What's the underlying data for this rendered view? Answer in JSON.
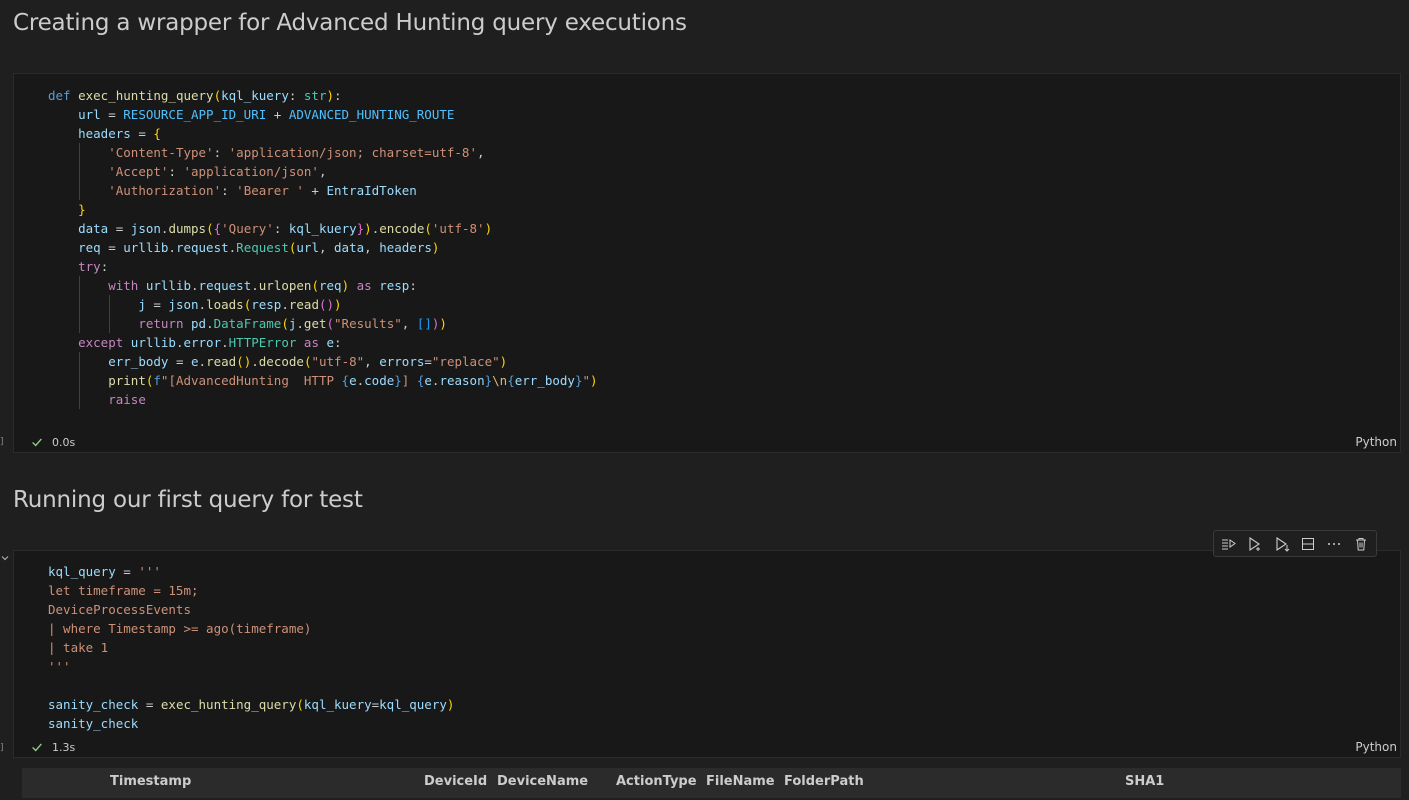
{
  "headings": {
    "first": "Creating a wrapper for Advanced Hunting query executions",
    "second": "Running our first query for test"
  },
  "cell1": {
    "exec_time": "0.0s",
    "language": "Python",
    "code": [
      [
        [
          "kw",
          "def "
        ],
        [
          "fn",
          "exec_hunting_query"
        ],
        [
          "p1",
          "("
        ],
        [
          "vr",
          "kql_kuery"
        ],
        [
          "op",
          ": "
        ],
        [
          "ty",
          "str"
        ],
        [
          "p1",
          ")"
        ],
        [
          "op",
          ":"
        ]
      ],
      [
        [
          "op",
          "    "
        ],
        [
          "vr",
          "url"
        ],
        [
          "op",
          " = "
        ],
        [
          "cn",
          "RESOURCE_APP_ID_URI"
        ],
        [
          "op",
          " + "
        ],
        [
          "cn",
          "ADVANCED_HUNTING_ROUTE"
        ]
      ],
      [
        [
          "op",
          "    "
        ],
        [
          "vr",
          "headers"
        ],
        [
          "op",
          " = "
        ],
        [
          "p1",
          "{"
        ]
      ],
      [
        [
          "op",
          "        "
        ],
        [
          "st",
          "'Content-Type'"
        ],
        [
          "op",
          ": "
        ],
        [
          "st",
          "'application/json; charset=utf-8'"
        ],
        [
          "op",
          ","
        ]
      ],
      [
        [
          "op",
          "        "
        ],
        [
          "st",
          "'Accept'"
        ],
        [
          "op",
          ": "
        ],
        [
          "st",
          "'application/json'"
        ],
        [
          "op",
          ","
        ]
      ],
      [
        [
          "op",
          "        "
        ],
        [
          "st",
          "'Authorization'"
        ],
        [
          "op",
          ": "
        ],
        [
          "st",
          "'Bearer '"
        ],
        [
          "op",
          " + "
        ],
        [
          "vr",
          "EntraIdToken"
        ]
      ],
      [
        [
          "op",
          "    "
        ],
        [
          "p1",
          "}"
        ]
      ],
      [
        [
          "op",
          "    "
        ],
        [
          "vr",
          "data"
        ],
        [
          "op",
          " = "
        ],
        [
          "vr",
          "json"
        ],
        [
          "op",
          "."
        ],
        [
          "fn",
          "dumps"
        ],
        [
          "p1",
          "("
        ],
        [
          "p2",
          "{"
        ],
        [
          "st",
          "'Query'"
        ],
        [
          "op",
          ": "
        ],
        [
          "vr",
          "kql_kuery"
        ],
        [
          "p2",
          "}"
        ],
        [
          "p1",
          ")"
        ],
        [
          "op",
          "."
        ],
        [
          "fn",
          "encode"
        ],
        [
          "p1",
          "("
        ],
        [
          "st",
          "'utf-8'"
        ],
        [
          "p1",
          ")"
        ]
      ],
      [
        [
          "op",
          "    "
        ],
        [
          "vr",
          "req"
        ],
        [
          "op",
          " = "
        ],
        [
          "vr",
          "urllib"
        ],
        [
          "op",
          "."
        ],
        [
          "vr",
          "request"
        ],
        [
          "op",
          "."
        ],
        [
          "ty",
          "Request"
        ],
        [
          "p1",
          "("
        ],
        [
          "vr",
          "url"
        ],
        [
          "op",
          ", "
        ],
        [
          "vr",
          "data"
        ],
        [
          "op",
          ", "
        ],
        [
          "vr",
          "headers"
        ],
        [
          "p1",
          ")"
        ]
      ],
      [
        [
          "op",
          "    "
        ],
        [
          "ctl",
          "try"
        ],
        [
          "op",
          ":"
        ]
      ],
      [
        [
          "op",
          "        "
        ],
        [
          "ctl",
          "with "
        ],
        [
          "vr",
          "urllib"
        ],
        [
          "op",
          "."
        ],
        [
          "vr",
          "request"
        ],
        [
          "op",
          "."
        ],
        [
          "fn",
          "urlopen"
        ],
        [
          "p1",
          "("
        ],
        [
          "vr",
          "req"
        ],
        [
          "p1",
          ")"
        ],
        [
          "ctl",
          " as "
        ],
        [
          "vr",
          "resp"
        ],
        [
          "op",
          ":"
        ]
      ],
      [
        [
          "op",
          "            "
        ],
        [
          "vr",
          "j"
        ],
        [
          "op",
          " = "
        ],
        [
          "vr",
          "json"
        ],
        [
          "op",
          "."
        ],
        [
          "fn",
          "loads"
        ],
        [
          "p1",
          "("
        ],
        [
          "vr",
          "resp"
        ],
        [
          "op",
          "."
        ],
        [
          "fn",
          "read"
        ],
        [
          "p2",
          "()"
        ],
        [
          "p1",
          ")"
        ]
      ],
      [
        [
          "op",
          "            "
        ],
        [
          "ctl",
          "return "
        ],
        [
          "vr",
          "pd"
        ],
        [
          "op",
          "."
        ],
        [
          "ty",
          "DataFrame"
        ],
        [
          "p1",
          "("
        ],
        [
          "vr",
          "j"
        ],
        [
          "op",
          "."
        ],
        [
          "fn",
          "get"
        ],
        [
          "p2",
          "("
        ],
        [
          "st",
          "\"Results\""
        ],
        [
          "op",
          ", "
        ],
        [
          "p3",
          "[]"
        ],
        [
          "p2",
          ")"
        ],
        [
          "p1",
          ")"
        ]
      ],
      [
        [
          "op",
          "    "
        ],
        [
          "ctl",
          "except "
        ],
        [
          "vr",
          "urllib"
        ],
        [
          "op",
          "."
        ],
        [
          "vr",
          "error"
        ],
        [
          "op",
          "."
        ],
        [
          "ty",
          "HTTPError"
        ],
        [
          "ctl",
          " as "
        ],
        [
          "vr",
          "e"
        ],
        [
          "op",
          ":"
        ]
      ],
      [
        [
          "op",
          "        "
        ],
        [
          "vr",
          "err_body"
        ],
        [
          "op",
          " = "
        ],
        [
          "vr",
          "e"
        ],
        [
          "op",
          "."
        ],
        [
          "fn",
          "read"
        ],
        [
          "p1",
          "()"
        ],
        [
          "op",
          "."
        ],
        [
          "fn",
          "decode"
        ],
        [
          "p1",
          "("
        ],
        [
          "st",
          "\"utf-8\""
        ],
        [
          "op",
          ", "
        ],
        [
          "vr",
          "errors"
        ],
        [
          "op",
          "="
        ],
        [
          "st",
          "\"replace\""
        ],
        [
          "p1",
          ")"
        ]
      ],
      [
        [
          "op",
          "        "
        ],
        [
          "fn",
          "print"
        ],
        [
          "p1",
          "("
        ],
        [
          "kw",
          "f"
        ],
        [
          "st",
          "\"[AdvancedHunting  HTTP "
        ],
        [
          "kw",
          "{"
        ],
        [
          "vr",
          "e"
        ],
        [
          "op",
          "."
        ],
        [
          "vr",
          "code"
        ],
        [
          "kw",
          "}"
        ],
        [
          "st",
          "] "
        ],
        [
          "kw",
          "{"
        ],
        [
          "vr",
          "e"
        ],
        [
          "op",
          "."
        ],
        [
          "vr",
          "reason"
        ],
        [
          "kw",
          "}"
        ],
        [
          "es",
          "\\n"
        ],
        [
          "kw",
          "{"
        ],
        [
          "vr",
          "err_body"
        ],
        [
          "kw",
          "}"
        ],
        [
          "st",
          "\""
        ],
        [
          "p1",
          ")"
        ]
      ],
      [
        [
          "op",
          "        "
        ],
        [
          "ctl",
          "raise"
        ]
      ]
    ]
  },
  "cell2": {
    "exec_time": "1.3s",
    "language": "Python",
    "code": [
      [
        [
          "vr",
          "kql_query"
        ],
        [
          "op",
          " = "
        ],
        [
          "st",
          "'''"
        ]
      ],
      [
        [
          "st",
          "let timeframe = 15m;"
        ]
      ],
      [
        [
          "st",
          "DeviceProcessEvents"
        ]
      ],
      [
        [
          "st",
          "| where Timestamp >= ago(timeframe)"
        ]
      ],
      [
        [
          "st",
          "| take 1"
        ]
      ],
      [
        [
          "st",
          "'''"
        ]
      ],
      [
        [
          "op",
          " "
        ]
      ],
      [
        [
          "vr",
          "sanity_check"
        ],
        [
          "op",
          " = "
        ],
        [
          "fn",
          "exec_hunting_query"
        ],
        [
          "p1",
          "("
        ],
        [
          "vr",
          "kql_kuery"
        ],
        [
          "op",
          "="
        ],
        [
          "vr",
          "kql_query"
        ],
        [
          "p1",
          ")"
        ]
      ],
      [
        [
          "vr",
          "sanity_check"
        ]
      ]
    ]
  },
  "toolbar": {
    "icons": [
      "execute-above-icon",
      "execute-cell-below-icon",
      "execute-below-icon",
      "split-cell-icon",
      "more-icon",
      "delete-icon"
    ]
  },
  "table": {
    "columns": [
      "Timestamp",
      "DeviceId",
      "DeviceName",
      "ActionType",
      "FileName",
      "FolderPath",
      "SHA1"
    ]
  }
}
